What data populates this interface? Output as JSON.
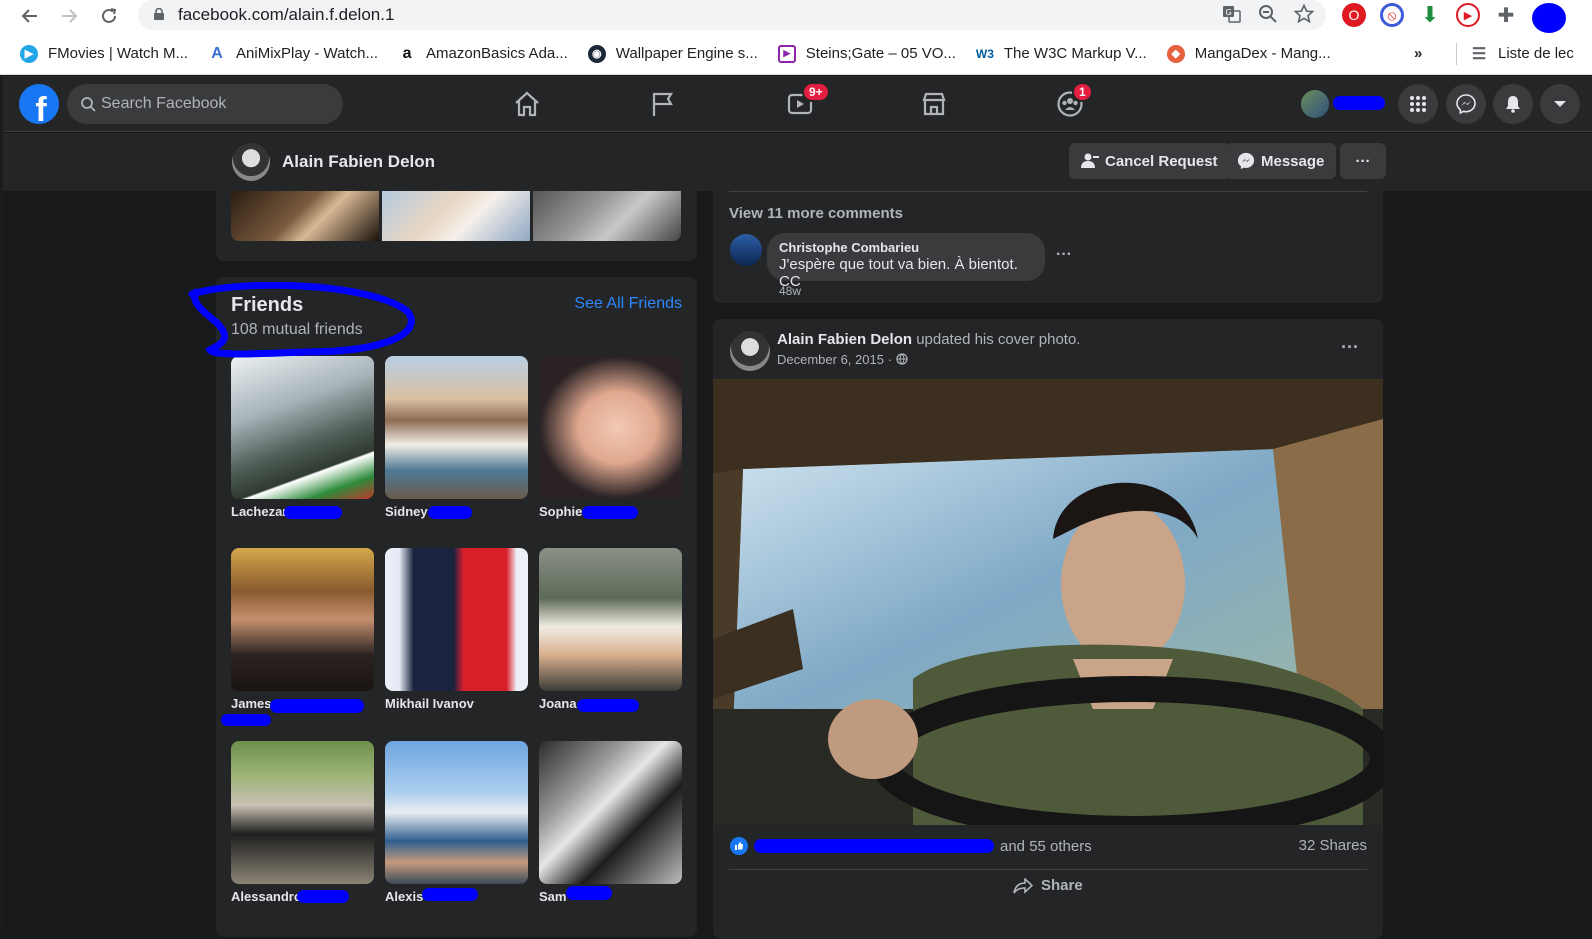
{
  "browser": {
    "url": "facebook.com/alain.f.delon.1",
    "bookmarks": [
      {
        "label": "FMovies | Watch M...",
        "icon": "play-circle-icon",
        "color": "#23a6e8"
      },
      {
        "label": "AniMixPlay - Watch...",
        "icon": "animix-icon",
        "color": "#3a6fd8"
      },
      {
        "label": "AmazonBasics Ada...",
        "icon": "amazon-icon",
        "color": "#111111"
      },
      {
        "label": "Wallpaper Engine s...",
        "icon": "steam-icon",
        "color": "#1b2838"
      },
      {
        "label": "Steins;Gate – 05 VO...",
        "icon": "video-icon",
        "color": "#8e24aa"
      },
      {
        "label": "The W3C Markup V...",
        "icon": "w3c-icon",
        "color": "#005a9c"
      },
      {
        "label": "MangaDex - Mang...",
        "icon": "mangadex-icon",
        "color": "#e6613e"
      }
    ],
    "bookmarks_overflow": "»",
    "reading_list": "Liste de lec"
  },
  "fb": {
    "search_placeholder": "Search Facebook",
    "watch_badge": "9+",
    "groups_badge": "1"
  },
  "profile": {
    "name": "Alain Fabien Delon",
    "cancel_request": "Cancel Request",
    "message": "Message",
    "more": "···"
  },
  "friends": {
    "title": "Friends",
    "mutual": "108 mutual friends",
    "see_all": "See All Friends",
    "list": [
      {
        "name": "Lachezar"
      },
      {
        "name": "Sidney"
      },
      {
        "name": "Sophie"
      },
      {
        "name": "James"
      },
      {
        "name": "Mikhail Ivanov"
      },
      {
        "name": "Joana"
      },
      {
        "name": "Alessandro"
      },
      {
        "name": "Alexis"
      },
      {
        "name": "Sam"
      }
    ]
  },
  "comments": {
    "view_more": "View 11 more comments",
    "author": "Christophe Combarieu",
    "text": "J'espère que tout va bien. À bientot. CC",
    "time": "48w",
    "more": "···"
  },
  "post": {
    "author": "Alain Fabien Delon",
    "action": "updated his cover photo.",
    "date": "December 6, 2015 ·",
    "more": "···",
    "reactions_suffix": "and 55 others",
    "shares": "32 Shares",
    "share_label": "Share"
  },
  "colors": {
    "fb_blue": "#1877f2",
    "link_blue": "#2d88ff",
    "surface": "#242526",
    "background": "#18191a",
    "redaction": "#0000ff"
  }
}
